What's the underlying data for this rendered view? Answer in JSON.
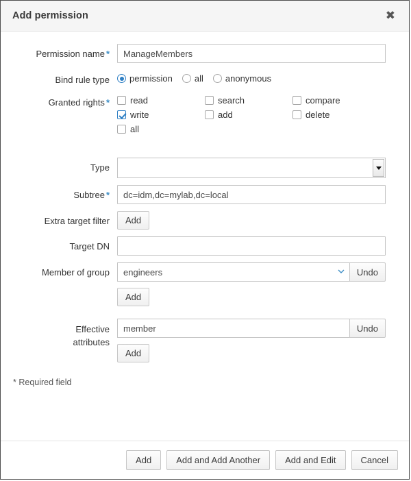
{
  "dialog": {
    "title": "Add permission",
    "close_icon": "close-icon",
    "required_note": "* Required field"
  },
  "fields": {
    "permission_name": {
      "label": "Permission name",
      "required": "*",
      "value": "ManageMembers",
      "placeholder": ""
    },
    "bind_rule_type": {
      "label": "Bind rule type",
      "options": [
        {
          "label": "permission",
          "selected": true
        },
        {
          "label": "all",
          "selected": false
        },
        {
          "label": "anonymous",
          "selected": false
        }
      ]
    },
    "granted_rights": {
      "label": "Granted rights",
      "required": "*",
      "options": [
        {
          "label": "read",
          "checked": false
        },
        {
          "label": "search",
          "checked": false
        },
        {
          "label": "compare",
          "checked": false
        },
        {
          "label": "write",
          "checked": true
        },
        {
          "label": "add",
          "checked": false
        },
        {
          "label": "delete",
          "checked": false
        },
        {
          "label": "all",
          "checked": false
        }
      ]
    },
    "type": {
      "label": "Type",
      "value": "",
      "options": [
        ""
      ]
    },
    "subtree": {
      "label": "Subtree",
      "required": "*",
      "value": "dc=idm,dc=mylab,dc=local",
      "placeholder": ""
    },
    "extra_target_filter": {
      "label": "Extra target filter",
      "add_label": "Add"
    },
    "target_dn": {
      "label": "Target DN",
      "value": "",
      "placeholder": ""
    },
    "member_of_group": {
      "label": "Member of group",
      "value": "engineers",
      "placeholder": "",
      "undo_label": "Undo",
      "add_label": "Add"
    },
    "effective_attributes": {
      "label_line1": "Effective",
      "label_line2": "attributes",
      "value": "member",
      "placeholder": "",
      "undo_label": "Undo",
      "add_label": "Add"
    }
  },
  "footer": {
    "add": "Add",
    "add_and_add_another": "Add and Add Another",
    "add_and_edit": "Add and Edit",
    "cancel": "Cancel"
  },
  "colors": {
    "accent": "#2e7fc4",
    "required_asterisk": "#3c8dc5",
    "header_bg": "#f5f5f5",
    "border": "#4d4d4d"
  }
}
